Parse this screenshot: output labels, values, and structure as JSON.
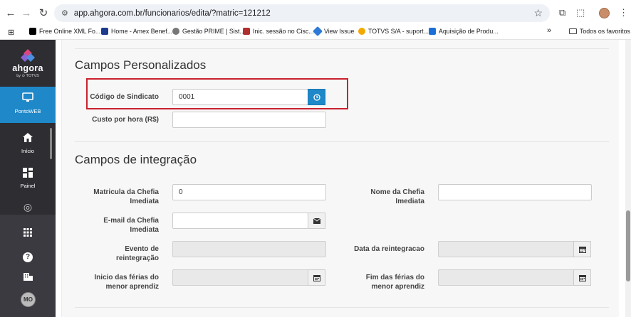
{
  "browser": {
    "url": "app.ahgora.com.br/funcionarios/edita/?matric=121212",
    "bookmarks": [
      {
        "label": "Free Online XML Fo...",
        "color": "#000000"
      },
      {
        "label": "Home - Amex Benef...",
        "color": "#1d3b8f"
      },
      {
        "label": "Gestão PRIME | Sist...",
        "color": "#555555"
      },
      {
        "label": "Inic. sessão no Cisc...",
        "color": "#b03030"
      },
      {
        "label": "View Issue",
        "color": "#2f7ad6"
      },
      {
        "label": "TOTVS S/A - suport...",
        "color": "#f2a900"
      },
      {
        "label": "Aquisição de Produ...",
        "color": "#1c6fd6"
      }
    ],
    "overflow": "»",
    "all_bookmarks": "Todos os favoritos"
  },
  "sidebar": {
    "brand": "ahgora",
    "brand_sub": "by ⊙ TOTVS",
    "active": "PontoWEB",
    "items": [
      {
        "label": "Início"
      },
      {
        "label": "Painel"
      }
    ],
    "user_initials": "MO"
  },
  "sections": {
    "custom_title": "Campos Personalizados",
    "integration_title": "Campos de integração"
  },
  "fields": {
    "codigo_sindicato": {
      "label": "Código de Sindicato",
      "value": "0001"
    },
    "custo_hora": {
      "label": "Custo por hora (R$)",
      "value": ""
    },
    "matricula_chefia": {
      "label": "Matricula da Chefia Imediata",
      "value": "0"
    },
    "nome_chefia": {
      "label": "Nome da Chefia Imediata",
      "value": ""
    },
    "email_chefia": {
      "label": "E-mail da Chefia Imediata",
      "value": ""
    },
    "evento_reintegracao": {
      "label": "Evento de reintegração",
      "value": ""
    },
    "data_reintegracao": {
      "label": "Data da reintegracao",
      "value": ""
    },
    "inicio_ferias": {
      "label": "Inicio das férias do menor aprendiz",
      "value": ""
    },
    "fim_ferias": {
      "label": "Fim das férias do menor aprendiz",
      "value": ""
    }
  }
}
